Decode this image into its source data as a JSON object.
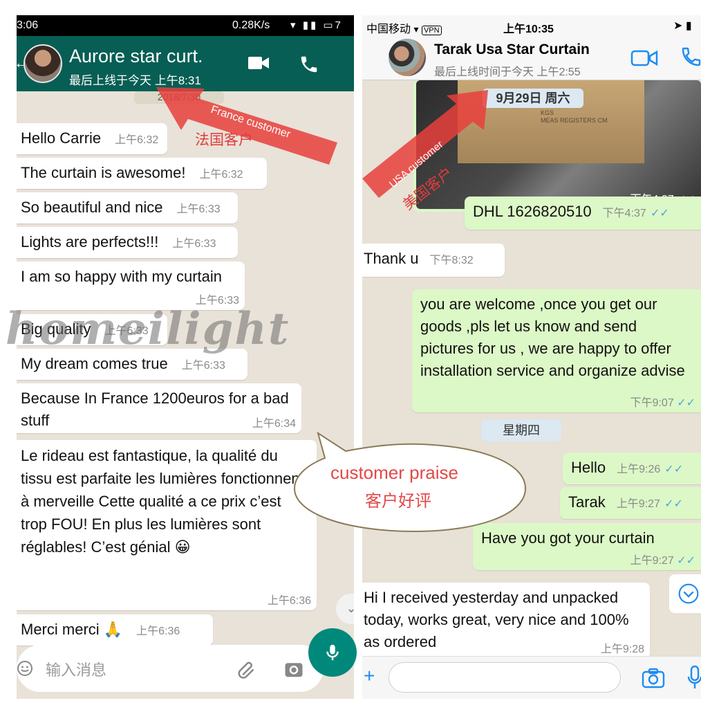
{
  "left_chat": {
    "status_bar": {
      "time": "3:06",
      "rate": "0.28K/s"
    },
    "header": {
      "contact_name": "Aurore star curt.",
      "last_seen": "最后上线于今天 上午8:31"
    },
    "date_label": "2018/7/30",
    "messages": [
      {
        "text": "Hello Carrie",
        "time": "上午6:32"
      },
      {
        "text": "The curtain is awesome!",
        "time": "上午6:32"
      },
      {
        "text": "So beautiful and nice",
        "time": "上午6:33"
      },
      {
        "text": "Lights are perfects!!!",
        "time": "上午6:33"
      },
      {
        "text": "I am so happy with my curtain",
        "time": "上午6:33"
      },
      {
        "text": "Big quality",
        "time": "上午6:33"
      },
      {
        "text": "My dream comes true",
        "time": "上午6:33"
      },
      {
        "text": "Because In France 1200euros for a bad stuff",
        "time": "上午6:34"
      },
      {
        "text": "Le rideau est fantastique, la qualité du tissu est parfaite les lumières fonctionnent à merveille Cette qualité a ce prix c’est trop FOU! En plus les lumières sont réglables! C’est génial 😀",
        "time": "上午6:36"
      },
      {
        "text": "Merci merci 🙏",
        "time": "上午6:36"
      }
    ],
    "input": {
      "placeholder": "输入消息"
    }
  },
  "right_chat": {
    "status_bar": {
      "carrier": "中国移动",
      "vpn": "VPN",
      "time": "上午10:35"
    },
    "header": {
      "contact_name": "Tarak Usa Star Curtain",
      "last_seen": "最后上线时间于今天 上午2:55"
    },
    "date_label": "9月29日 周六",
    "photo_time": "下午4:37",
    "photo_box_label": "PCS\nKGS\nKGS\nMEAS REGISTERS CM",
    "messages": [
      {
        "dir": "out",
        "text": "DHL 1626820510",
        "time": "下午4:37"
      },
      {
        "dir": "in",
        "text": "Thank u",
        "time": "下午8:32"
      },
      {
        "dir": "out",
        "text": "you are welcome ,once you get our goods ,pls let us know and send pictures for us , we are happy to offer installation service and organize advise",
        "time": "下午9:07"
      },
      {
        "dir": "out",
        "text": "Hello",
        "time": "上午9:26"
      },
      {
        "dir": "out",
        "text": "Tarak",
        "time": "上午9:27"
      },
      {
        "dir": "out",
        "text": "Have you got your curtain",
        "time": "上午9:27"
      },
      {
        "dir": "in",
        "text": "Hi I received yesterday and unpacked today, works great, very nice and 100% as ordered",
        "time": "上午9:28"
      }
    ],
    "day_label": "星期四"
  },
  "annotations": {
    "france_en": "France customer",
    "france_zh": "法国客户",
    "usa_en": "USA customer",
    "usa_zh": "美国客户",
    "praise_en": "customer praise",
    "praise_zh": "客户好评",
    "watermark": "homeilight"
  },
  "colors": {
    "whatsapp_green": "#075e54",
    "outgoing_bubble": "#dcf8c6",
    "annotation_red": "#e03c3c",
    "read_tick": "#4fa3e0"
  }
}
